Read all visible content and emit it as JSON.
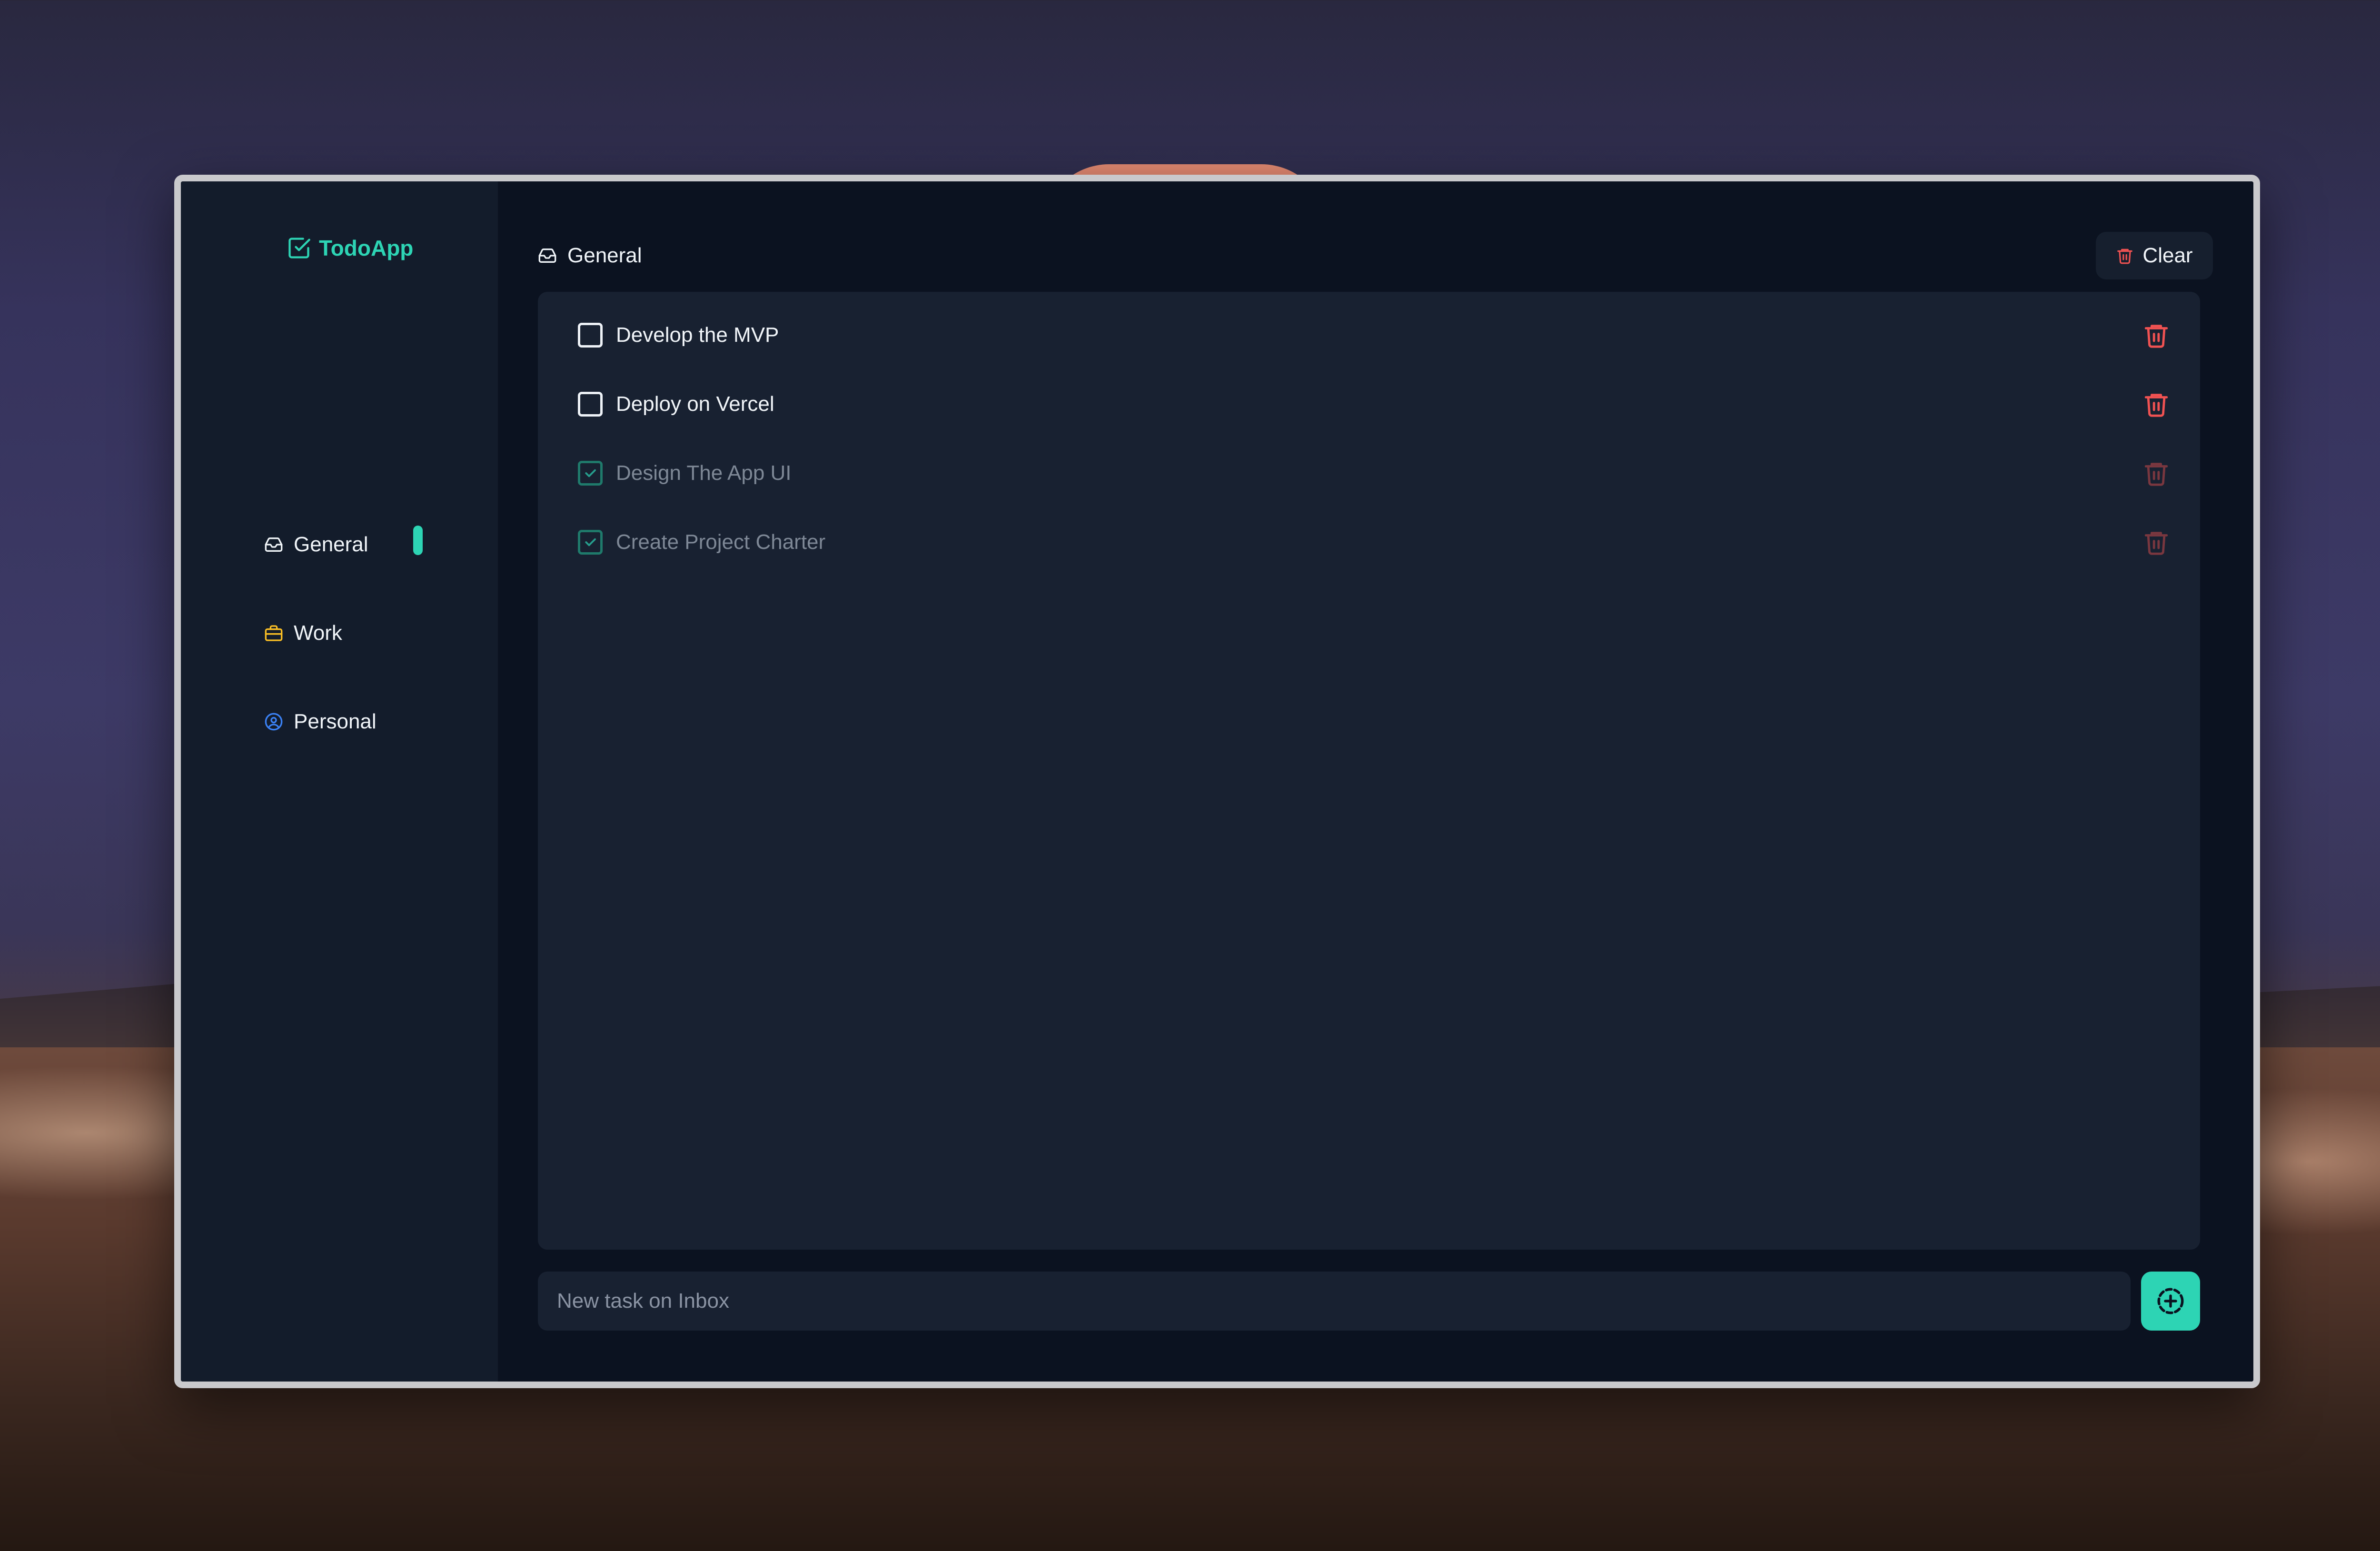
{
  "app": {
    "name": "TodoApp"
  },
  "sidebar": {
    "items": [
      {
        "label": "General",
        "icon": "inbox-icon",
        "color": "#f1f5f9",
        "active": true
      },
      {
        "label": "Work",
        "icon": "briefcase-icon",
        "color": "#fbbf24",
        "active": false
      },
      {
        "label": "Personal",
        "icon": "user-circle-icon",
        "color": "#3b82f6",
        "active": false
      }
    ]
  },
  "header": {
    "title": "General",
    "clear_label": "Clear"
  },
  "tasks": [
    {
      "text": "Develop the MVP",
      "done": false
    },
    {
      "text": "Deploy on Vercel",
      "done": false
    },
    {
      "text": "Design The App UI",
      "done": true
    },
    {
      "text": "Create Project Charter",
      "done": true
    }
  ],
  "composer": {
    "placeholder": "New task on Inbox"
  },
  "colors": {
    "accent": "#2dd4b4",
    "danger": "#f05252",
    "panel": "#182131",
    "sidebar": "#131c2b"
  }
}
